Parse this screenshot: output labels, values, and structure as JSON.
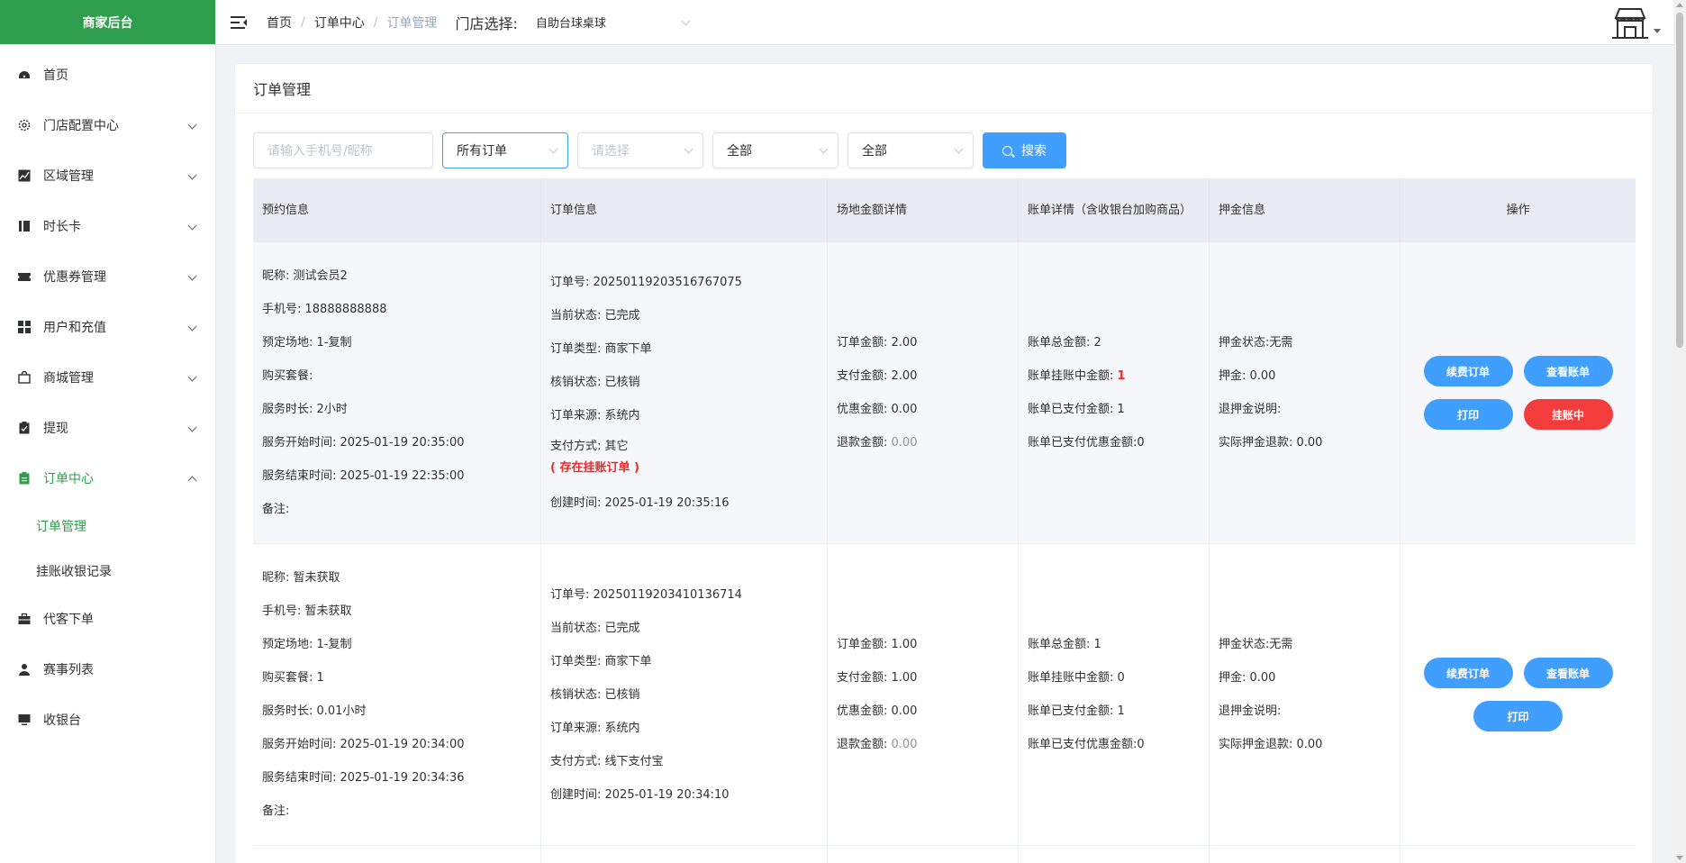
{
  "sidebar": {
    "brand": "商家后台",
    "items": [
      {
        "label": "首页",
        "icon": "dashboard-icon"
      },
      {
        "label": "门店配置中心",
        "icon": "gear-icon"
      },
      {
        "label": "区域管理",
        "icon": "chart-icon"
      },
      {
        "label": "时长卡",
        "icon": "card-icon"
      },
      {
        "label": "优惠券管理",
        "icon": "ticket-icon"
      },
      {
        "label": "用户和充值",
        "icon": "grid-icon"
      },
      {
        "label": "商城管理",
        "icon": "bag-icon"
      },
      {
        "label": "提现",
        "icon": "clipboard-icon"
      },
      {
        "label": "订单中心",
        "icon": "clipboard-icon"
      },
      {
        "label": "代客下单",
        "icon": "briefcase-icon"
      },
      {
        "label": "赛事列表",
        "icon": "user-icon"
      },
      {
        "label": "收银台",
        "icon": "monitor-icon"
      }
    ],
    "subitems": [
      "订单管理",
      "挂账收银记录"
    ]
  },
  "header": {
    "breadcrumb": [
      "首页",
      "订单中心",
      "订单管理"
    ],
    "store_label": "门店选择:",
    "store_value": "自助台球桌球"
  },
  "card": {
    "title": "订单管理"
  },
  "filters": {
    "phone_placeholder": "请输入手机号/昵称",
    "order_type": "所有订单",
    "select_placeholder": "请选择",
    "status1": "全部",
    "status2": "全部",
    "search_label": "搜索"
  },
  "table": {
    "headers": [
      "预约信息",
      "订单信息",
      "场地金额详情",
      "账单详情（含收银台加购商品）",
      "押金信息",
      "操作"
    ],
    "rows": [
      {
        "booking": [
          "昵称: 测试会员2",
          "手机号: 18888888888",
          "预定场地: 1-复制",
          "购买套餐:",
          "服务时长: 2小时",
          "服务开始时间: 2025-01-19 20:35:00",
          "服务结束时间: 2025-01-19 22:35:00",
          "备注:"
        ],
        "order": {
          "no": "订单号: 20250119203516767075",
          "status": "当前状态: 已完成",
          "type": "订单类型: 商家下单",
          "verify": "核销状态: 已核销",
          "source": "订单来源: 系统内",
          "pay": "支付方式: 其它",
          "note": "( 存在挂账订单 )",
          "created": "创建时间: 2025-01-19 20:35:16"
        },
        "venue": {
          "order_amt": "订单金额: 2.00",
          "pay_amt": "支付金额: 2.00",
          "discount": "优惠金额: 0.00",
          "refund_label": "退款金额: ",
          "refund_val": "0.00"
        },
        "bill": {
          "total": "账单总金额: 2",
          "pending_label": "账单挂账中金额: ",
          "pending_val": "1",
          "paid": "账单已支付金额: 1",
          "paid_discount": "账单已支付优惠金额:0"
        },
        "deposit": [
          "押金状态:无需",
          "押金: 0.00",
          "退押金说明:",
          "实际押金退款: 0.00"
        ],
        "actions": [
          "续费订单",
          "查看账单",
          "打印",
          "挂账中"
        ]
      },
      {
        "booking": [
          "昵称: 暂未获取",
          "手机号: 暂未获取",
          "预定场地: 1-复制",
          "购买套餐: 1",
          "服务时长: 0.01小时",
          "服务开始时间: 2025-01-19 20:34:00",
          "服务结束时间: 2025-01-19 20:34:36",
          "备注:"
        ],
        "order": {
          "no": "订单号: 20250119203410136714",
          "status": "当前状态: 已完成",
          "type": "订单类型: 商家下单",
          "verify": "核销状态: 已核销",
          "source": "订单来源: 系统内",
          "pay": "支付方式: 线下支付宝",
          "created": "创建时间: 2025-01-19 20:34:10"
        },
        "venue": {
          "order_amt": "订单金额: 1.00",
          "pay_amt": "支付金额: 1.00",
          "discount": "优惠金额: 0.00",
          "refund_label": "退款金额: ",
          "refund_val": "0.00"
        },
        "bill": {
          "total": "账单总金额: 1",
          "pending": "账单挂账中金额: 0",
          "paid": "账单已支付金额: 1",
          "paid_discount": "账单已支付优惠金额:0"
        },
        "deposit": [
          "押金状态:无需",
          "押金: 0.00",
          "退押金说明:",
          "实际押金退款: 0.00"
        ],
        "actions": [
          "续费订单",
          "查看账单",
          "打印"
        ]
      }
    ]
  },
  "colors": {
    "brand": "#2f9e4c",
    "primary": "#409eff",
    "danger": "#f33d3d",
    "warning_text": "#e52b2b"
  }
}
